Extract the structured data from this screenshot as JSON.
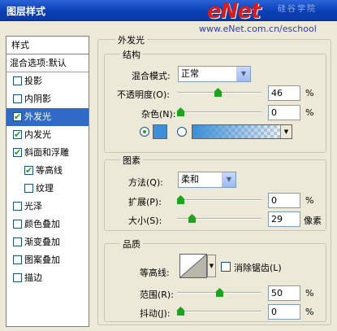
{
  "window": {
    "title": "图层样式"
  },
  "watermark": {
    "brand": "eNet",
    "brand_cn": "硅谷学院",
    "site": "www.eNet.com.cn/eschool"
  },
  "styles_panel": {
    "header": "样式",
    "blend_item": "混合选项:默认",
    "items": [
      {
        "label": "投影",
        "checked": false,
        "sub": false,
        "selected": false
      },
      {
        "label": "内阴影",
        "checked": false,
        "sub": false,
        "selected": false
      },
      {
        "label": "外发光",
        "checked": true,
        "sub": false,
        "selected": true
      },
      {
        "label": "内发光",
        "checked": true,
        "sub": false,
        "selected": false
      },
      {
        "label": "斜面和浮雕",
        "checked": true,
        "sub": false,
        "selected": false
      },
      {
        "label": "等高线",
        "checked": true,
        "sub": true,
        "selected": false
      },
      {
        "label": "纹理",
        "checked": false,
        "sub": true,
        "selected": false
      },
      {
        "label": "光泽",
        "checked": false,
        "sub": false,
        "selected": false
      },
      {
        "label": "颜色叠加",
        "checked": false,
        "sub": false,
        "selected": false
      },
      {
        "label": "渐变叠加",
        "checked": false,
        "sub": false,
        "selected": false
      },
      {
        "label": "图案叠加",
        "checked": false,
        "sub": false,
        "selected": false
      },
      {
        "label": "描边",
        "checked": false,
        "sub": false,
        "selected": false
      }
    ]
  },
  "outer_glow": {
    "title": "外发光",
    "structure": {
      "title": "结构",
      "blend_mode_label": "混合模式:",
      "blend_mode_value": "正常",
      "opacity_label": "不透明度(O):",
      "opacity_value": "46",
      "opacity_unit": "%",
      "noise_label": "杂色(N):",
      "noise_value": "0",
      "noise_unit": "%",
      "color": "#3c8fd8"
    },
    "elements": {
      "title": "图素",
      "technique_label": "方法(Q):",
      "technique_value": "柔和",
      "spread_label": "扩展(P):",
      "spread_value": "0",
      "spread_unit": "%",
      "size_label": "大小(S):",
      "size_value": "29",
      "size_unit": "像素"
    },
    "quality": {
      "title": "品质",
      "contour_label": "等高线:",
      "antialias_label": "消除锯齿(L)",
      "range_label": "范围(R):",
      "range_value": "50",
      "range_unit": "%",
      "jitter_label": "抖动(J):",
      "jitter_value": "0",
      "jitter_unit": "%"
    }
  }
}
